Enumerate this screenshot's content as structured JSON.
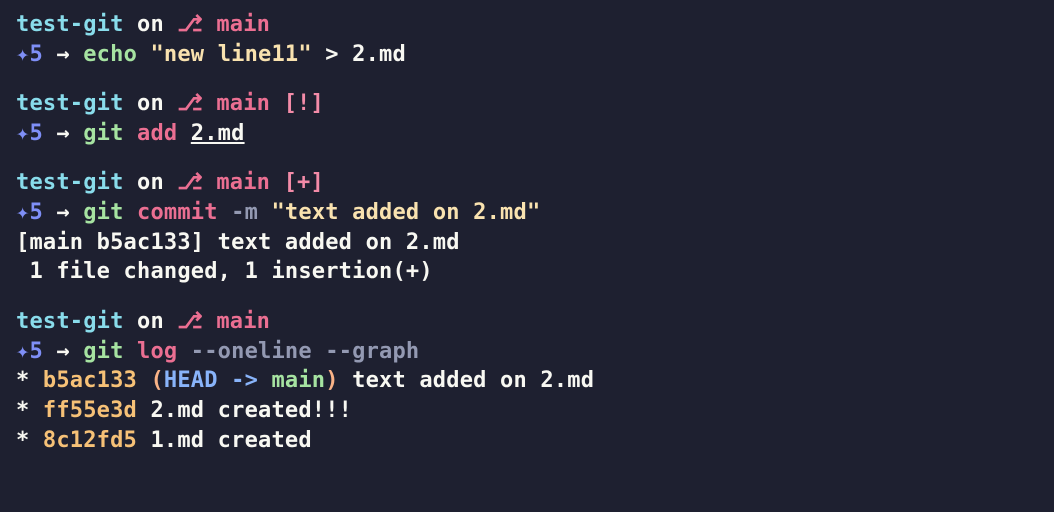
{
  "prompt": {
    "dir": "test-git",
    "on": " on ",
    "branch_icon": "⎇",
    "branch": " main",
    "status_dirty": " [!]",
    "status_staged": " [+]",
    "lead_glyph": "✦5",
    "arrow": " → "
  },
  "cmds": {
    "echo": {
      "cmd": "echo ",
      "arg_str": "\"new line11\"",
      "redir": " > ",
      "file": "2.md"
    },
    "add": {
      "cmd": "git ",
      "sub": "add ",
      "file": "2.md"
    },
    "commit": {
      "cmd": "git ",
      "sub": "commit ",
      "flag": "-m ",
      "msg": "\"text added on 2.md\""
    },
    "log": {
      "cmd": "git ",
      "sub": "log ",
      "flags": "--oneline --graph"
    }
  },
  "commit_out": {
    "l1": "[main b5ac133] text added on 2.md",
    "l2": " 1 file changed, 1 insertion(+)"
  },
  "log_out": {
    "star": "* ",
    "head": {
      "hash": "b5ac133 ",
      "open": "(",
      "head": "HEAD -> ",
      "branch": "main",
      "close": ") ",
      "msg": "text added on 2.md"
    },
    "r2": {
      "hash": "ff55e3d ",
      "msg": "2.md created!!!"
    },
    "r3": {
      "hash": "8c12fd5 ",
      "msg": "1.md created"
    }
  }
}
